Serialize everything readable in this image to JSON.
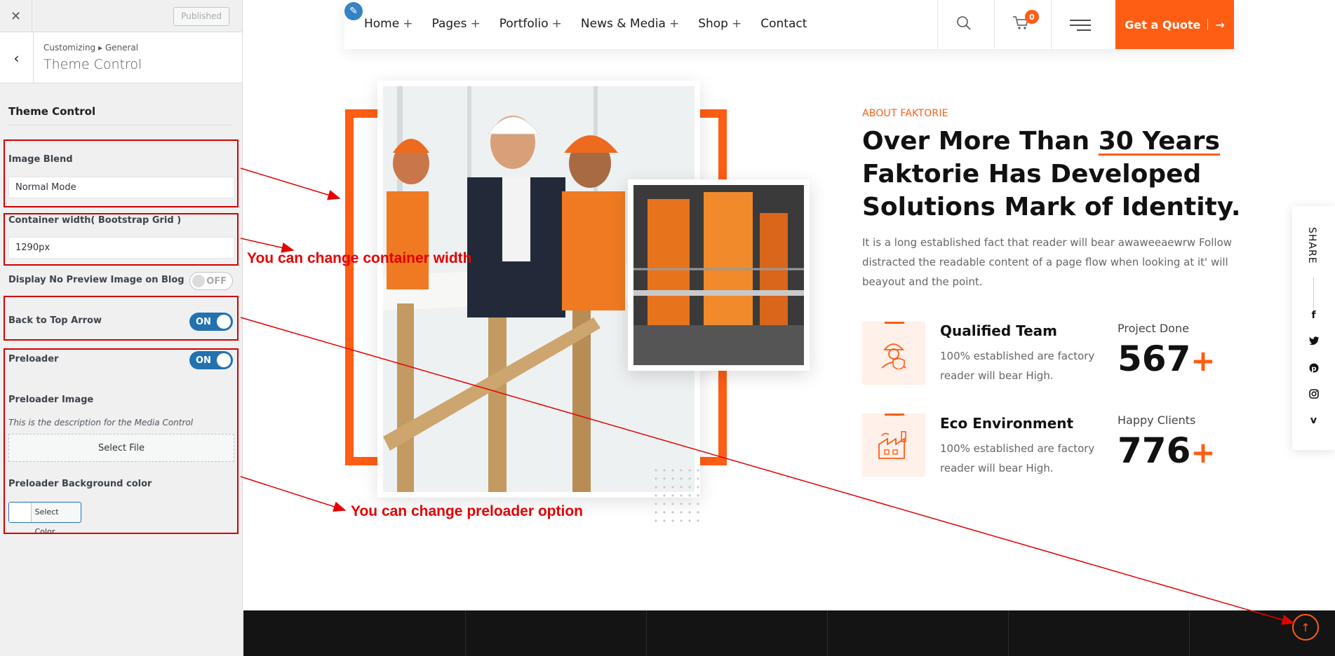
{
  "customizer": {
    "close_icon": "close-icon",
    "published_label": "Published",
    "breadcrumb": "Customizing ▸ General",
    "panel_title": "Theme Control",
    "section_title": "Theme Control",
    "image_blend": {
      "label": "Image Blend",
      "value": "Normal Mode"
    },
    "container_width": {
      "label": "Container width( Bootstrap Grid )",
      "value": "1290px"
    },
    "no_preview": {
      "label": "Display No Preview Image on Blog",
      "state": "OFF"
    },
    "back_to_top": {
      "label": "Back to Top Arrow",
      "state": "ON"
    },
    "preloader": {
      "label": "Preloader",
      "state": "ON"
    },
    "preloader_image": {
      "label": "Preloader Image",
      "description": "This is the description for the Media Control",
      "button": "Select File"
    },
    "preloader_bg": {
      "label": "Preloader Background color",
      "button": "Select Color"
    }
  },
  "annotations": {
    "container": "You can change container width",
    "preloader": "You can change preloader option",
    "color": "#e30000"
  },
  "nav": {
    "items": [
      "Home",
      "Pages",
      "Portfolio",
      "News & Media",
      "Shop",
      "Contact"
    ],
    "has_plus": [
      true,
      true,
      true,
      true,
      true,
      false
    ],
    "cart_count": "0",
    "cta": "Get a Quote",
    "accent": "#fe5d14"
  },
  "about": {
    "subtitle": "ABOUT FAKTORIE",
    "title_line1_a": "Over More Than ",
    "title_line1_b": "30 Years",
    "title_line2": "Faktorie Has Developed",
    "title_line3": "Solutions Mark of Identity.",
    "text": "It is a long established fact that reader will bear awaweeaewrw Follow distracted the readable content of a page flow when looking at it' will beayout and the point.",
    "features": [
      {
        "title": "Qualified Team",
        "text": "100% established are factory reader will bear High.",
        "icon": "worker-shield-icon"
      },
      {
        "title": "Eco Environment",
        "text": "100% established are factory reader will bear High.",
        "icon": "factory-icon"
      }
    ],
    "stats": [
      {
        "label": "Project Done",
        "value": "567",
        "suffix": "+"
      },
      {
        "label": "Happy Clients",
        "value": "776",
        "suffix": "+"
      }
    ]
  },
  "share": {
    "label": "SHARE",
    "icons": [
      "facebook-icon",
      "twitter-icon",
      "pinterest-icon",
      "instagram-icon",
      "vimeo-icon"
    ]
  }
}
